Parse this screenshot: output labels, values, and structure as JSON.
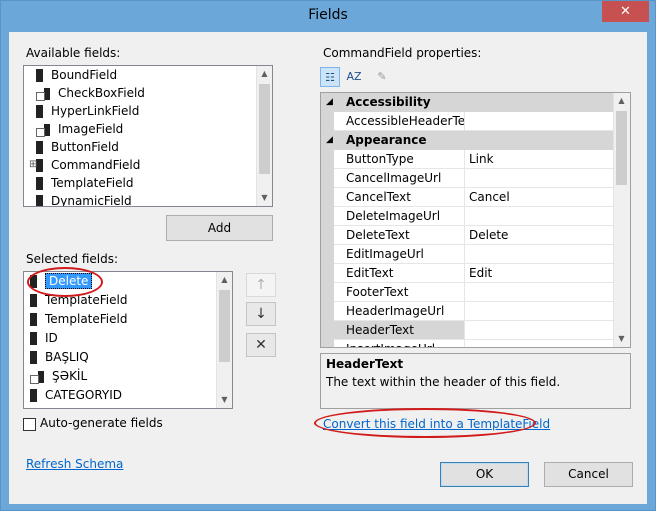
{
  "window": {
    "title": "Fields",
    "close_glyph": "✕"
  },
  "available": {
    "label": "Available fields:",
    "items": [
      "BoundField",
      "CheckBoxField",
      "HyperLinkField",
      "ImageField",
      "ButtonField",
      "CommandField",
      "TemplateField",
      "DynamicField"
    ],
    "add_label": "Add"
  },
  "selected": {
    "label": "Selected fields:",
    "items": [
      "Delete",
      "TemplateField",
      "TemplateField",
      "ID",
      "BAŞLIQ",
      "ŞƏKİL",
      "CATEGORYID"
    ],
    "selected_index": 0
  },
  "move": {
    "up": "↑",
    "down": "↓",
    "delete": "✕"
  },
  "autogen": {
    "label": "Auto-generate fields",
    "checked": false
  },
  "refresh_schema": "Refresh Schema",
  "props": {
    "label": "CommandField properties:",
    "rows": [
      {
        "type": "cat",
        "name": "Accessibility"
      },
      {
        "type": "prop",
        "name": "AccessibleHeaderText",
        "value": ""
      },
      {
        "type": "cat",
        "name": "Appearance"
      },
      {
        "type": "prop",
        "name": "ButtonType",
        "value": "Link"
      },
      {
        "type": "prop",
        "name": "CancelImageUrl",
        "value": ""
      },
      {
        "type": "prop",
        "name": "CancelText",
        "value": "Cancel"
      },
      {
        "type": "prop",
        "name": "DeleteImageUrl",
        "value": ""
      },
      {
        "type": "prop",
        "name": "DeleteText",
        "value": "Delete"
      },
      {
        "type": "prop",
        "name": "EditImageUrl",
        "value": ""
      },
      {
        "type": "prop",
        "name": "EditText",
        "value": "Edit"
      },
      {
        "type": "prop",
        "name": "FooterText",
        "value": ""
      },
      {
        "type": "prop",
        "name": "HeaderImageUrl",
        "value": ""
      },
      {
        "type": "prop",
        "name": "HeaderText",
        "value": "",
        "selected": true
      },
      {
        "type": "prop",
        "name": "InsertImageUrl",
        "value": ""
      }
    ],
    "description_title": "HeaderText",
    "description_text": "The text within the header of this field."
  },
  "convert_link": "Convert this field into a TemplateField",
  "ok_label": "OK",
  "cancel_label": "Cancel",
  "colors": {
    "title_bar": "#6ba7d9",
    "selection": "#3399ff",
    "annotation": "#d11a1a",
    "link": "#0066cc"
  }
}
